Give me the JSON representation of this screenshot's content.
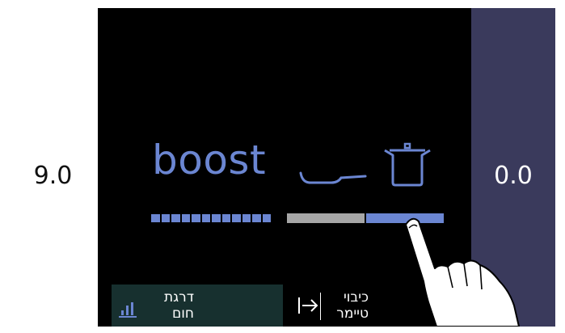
{
  "zones": {
    "left": {
      "value": "9.0"
    },
    "right": {
      "value": "0.0"
    }
  },
  "center": {
    "mode_label": "boost",
    "icons": [
      "pan-icon",
      "pot-icon"
    ],
    "level_bar": {
      "left_segments": 12,
      "selected_fraction": 0.5
    }
  },
  "buttons": {
    "heat_level": {
      "line1": "דרגת",
      "line2": "חום",
      "icon": "bar-chart-icon"
    },
    "timer_off": {
      "line1": "כיבוי",
      "line2": "טיימר",
      "icon": "arrow-to-end-icon"
    }
  },
  "colors": {
    "accent": "#6b86d2",
    "right_zone": "#3a3a5c",
    "button_bg": "#17302f",
    "bar_gray": "#a6a6a6"
  }
}
